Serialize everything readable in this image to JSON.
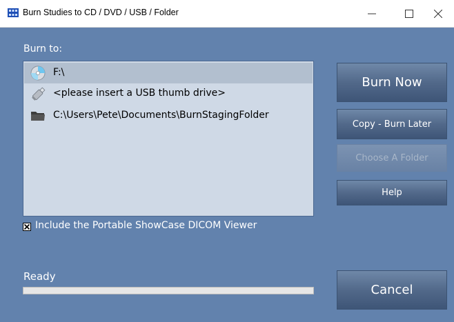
{
  "window": {
    "title": "Burn Studies to CD / DVD / USB / Folder",
    "controls": {
      "minimize": "—",
      "maximize": "☐",
      "close": "✕"
    }
  },
  "burn_to": {
    "label": "Burn to:",
    "items": [
      {
        "text": "F:\\",
        "icon": "cd-drive-icon",
        "selected": true
      },
      {
        "text": "<please insert a USB thumb drive>",
        "icon": "usb-drive-icon",
        "selected": false
      },
      {
        "text": "C:\\Users\\Pete\\Documents\\BurnStagingFolder",
        "icon": "folder-icon",
        "selected": false
      }
    ]
  },
  "options": {
    "include_viewer_label": "Include the Portable ShowCase DICOM Viewer",
    "include_viewer_checked": true,
    "checkbox_mark": "✕"
  },
  "status": {
    "text": "Ready",
    "progress": 0
  },
  "buttons": {
    "burn_now": "Burn Now",
    "copy_burn_later": "Copy - Burn Later",
    "choose_folder": "Choose A Folder",
    "choose_folder_enabled": false,
    "help": "Help",
    "cancel": "Cancel"
  },
  "colors": {
    "background": "#6282ad",
    "list_background": "#cfd9e6",
    "selected_row": "#b2bfcf",
    "button_top": "#6f88a8",
    "button_bottom": "#3e5577"
  }
}
